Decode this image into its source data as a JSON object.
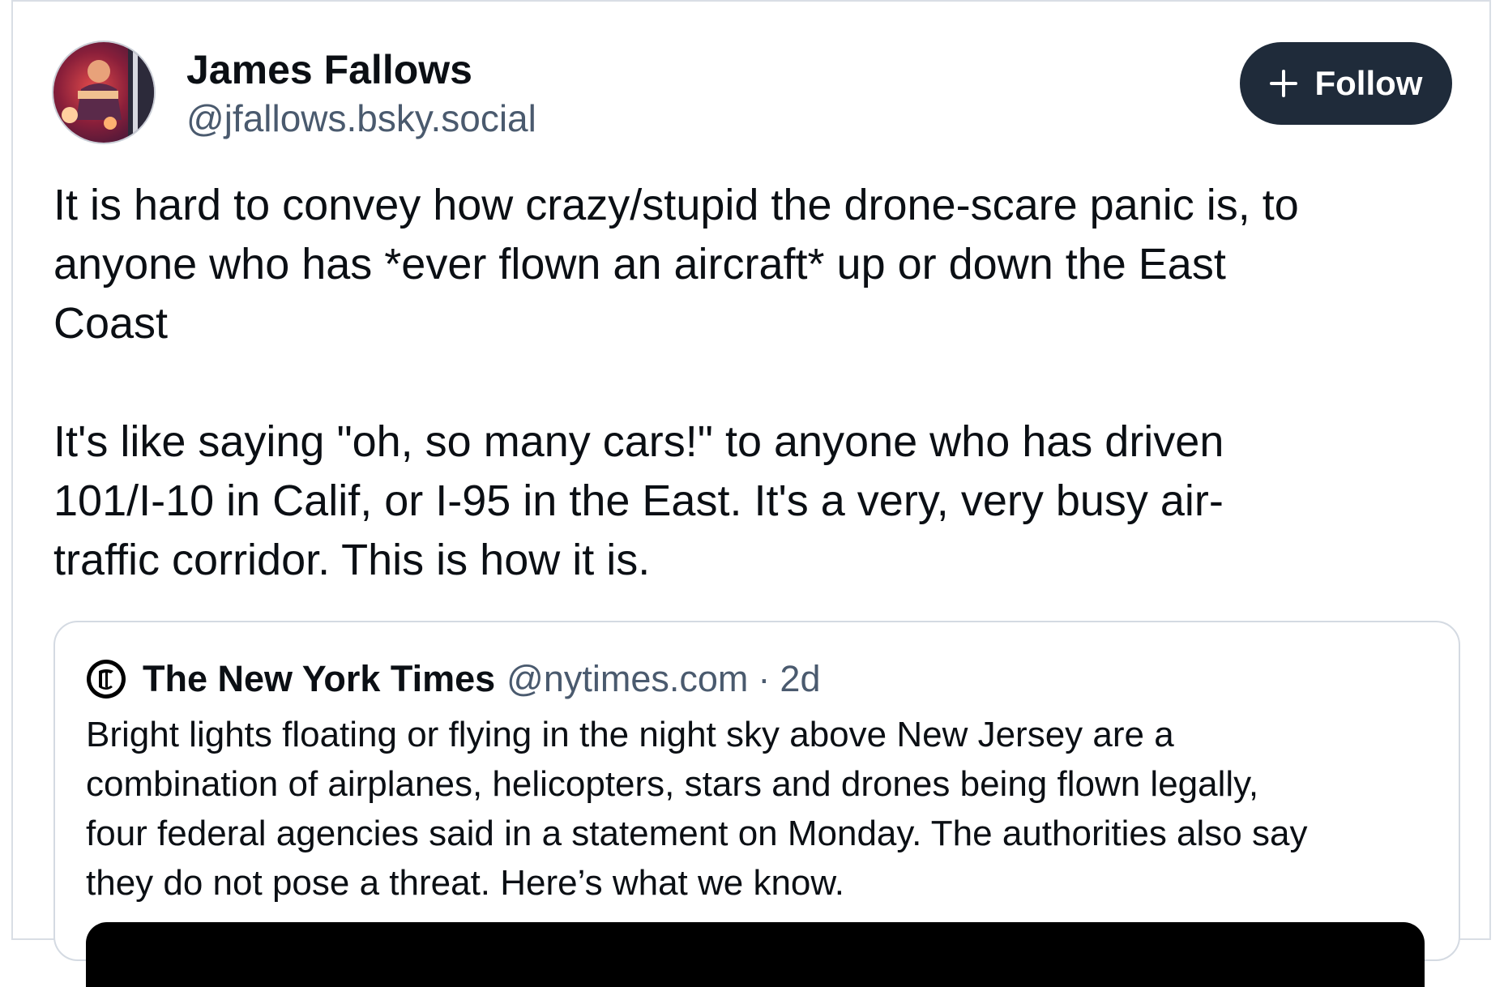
{
  "post": {
    "author": {
      "name": "James Fallows",
      "handle": "@jfallows.bsky.social"
    },
    "follow_label": "Follow",
    "text_lines": [
      "It is hard to convey how crazy/stupid the drone-scare panic is, to",
      "anyone who has *ever flown an aircraft* up or down the East",
      "Coast",
      "It's like saying \"oh, so many cars!\" to anyone who has driven",
      "101/I-10 in Calif, or I-95 in the East. It's a very, very busy air-",
      "traffic corridor. This is how it is."
    ]
  },
  "quote": {
    "name": "The New York Times",
    "handle": "@nytimes.com",
    "separator": "·",
    "time": "2d",
    "text_lines": [
      "Bright lights floating or flying in the night sky above New Jersey are a",
      "combination of airplanes, helicopters, stars and drones being flown legally,",
      "four federal agencies said in a statement on Monday. The authorities also say",
      "they do not pose a threat. Here’s what we know."
    ]
  },
  "icons": {
    "avatar": "profile-photo",
    "follow": "plus-icon",
    "quote_source": "nyt-logo-icon"
  },
  "colors": {
    "follow_button_bg": "#1f2b3a",
    "handle_text": "#4a5a6e",
    "border": "#d9dee5"
  }
}
